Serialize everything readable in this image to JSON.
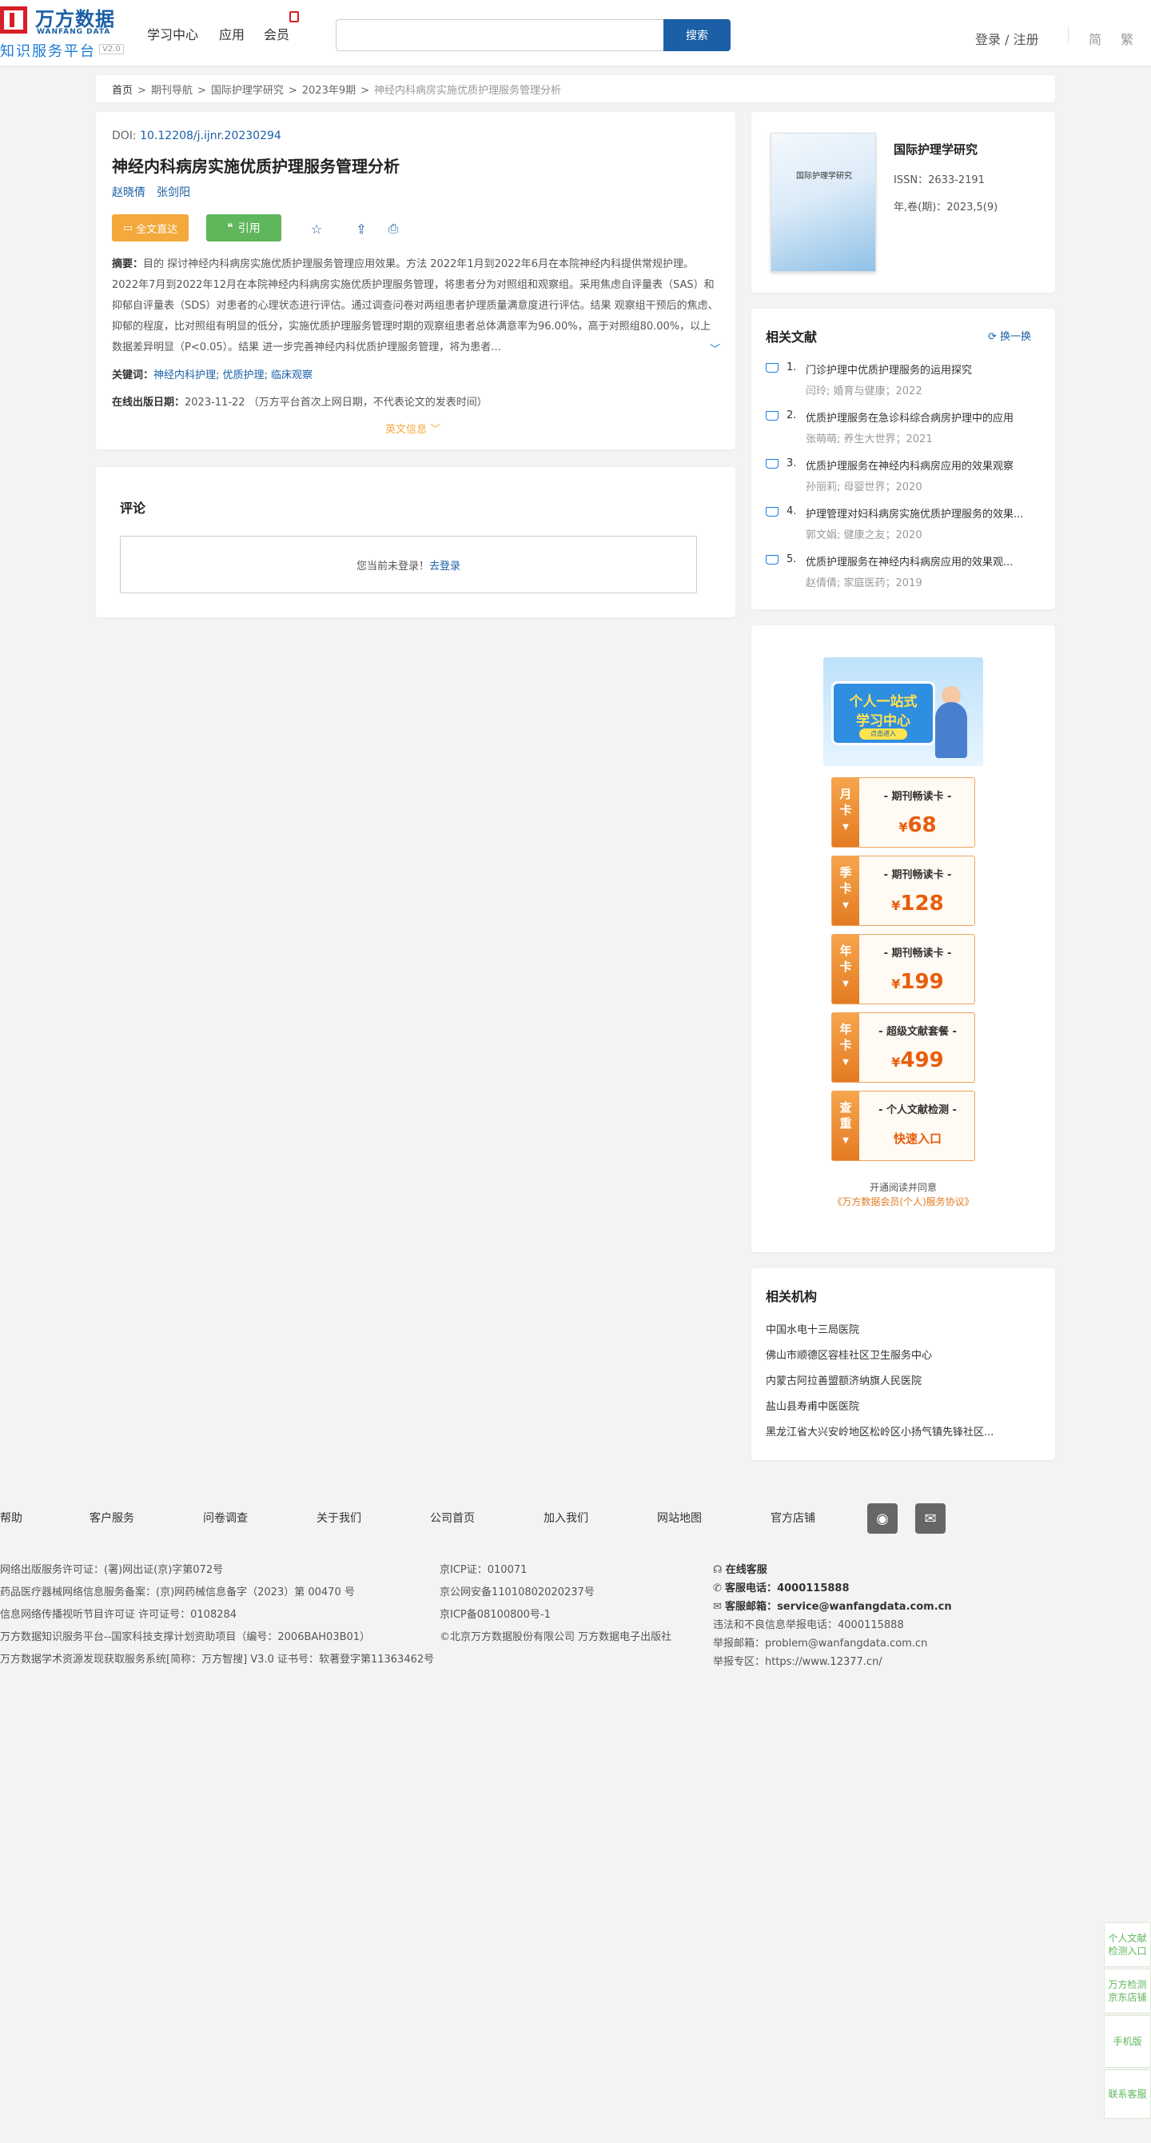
{
  "header": {
    "logo_cn": "万方数据",
    "logo_en": "WANFANG DATA",
    "logo_sub": "知识服务平台",
    "logo_version": "V2.0",
    "nav": [
      "学习中心",
      "应用",
      "会员"
    ],
    "search_placeholder": "",
    "search_button": "搜索",
    "login": "登录 / 注册",
    "lang_simplified": "简",
    "lang_traditional": "繁"
  },
  "breadcrumb": {
    "home": "首页",
    "items": [
      "期刊导航",
      "国际护理学研究",
      "2023年9期"
    ],
    "current": "神经内科病房实施优质护理服务管理分析",
    "separator": ">"
  },
  "article": {
    "doi_label": "DOI:",
    "doi": "10.12208/j.ijnr.20230294",
    "title": "神经内科病房实施优质护理服务管理分析",
    "authors": [
      "赵晓倩",
      "张剑阳"
    ],
    "btn_full": "全文直达",
    "btn_cite": "引用",
    "abstract_label": "摘要：",
    "abstract": "目的 探讨神经内科病房实施优质护理服务管理应用效果。方法 2022年1月到2022年6月在本院神经内科提供常规护理。2022年7月到2022年12月在本院神经内科病房实施优质护理服务管理，将患者分为对照组和观察组。采用焦虑自评量表（SAS）和抑郁自评量表（SDS）对患者的心理状态进行评估。通过调查问卷对两组患者护理质量满意度进行评估。结果 观察组干预后的焦虑、抑郁的程度，比对照组有明显的低分，实施优质护理服务管理时期的观察组患者总体满意率为96.00%，高于对照组80.00%，以上数据差异明显（P<0.05）。结果 进一步完善神经内科优质护理服务管理，将为患者...",
    "keywords_label": "关键词：",
    "keywords": "神经内科护理; 优质护理; 临床观察",
    "online_label": "在线出版日期：",
    "online_date": "2023-11-22",
    "online_note": "（万方平台首次上网日期，不代表论文的发表时间）",
    "en_info": "英文信息"
  },
  "comment": {
    "title": "评论",
    "notice": "您当前未登录！",
    "login_link": "去登录"
  },
  "journal": {
    "cover_title": "国际护理学研究",
    "name": "国际护理学研究",
    "issn": "ISSN：2633-2191",
    "volume": "年,卷(期)：2023,5(9)"
  },
  "related": {
    "title": "相关文献",
    "refresh": "换一换",
    "items": [
      {
        "num": "1.",
        "title": "门诊护理中优质护理服务的运用探究",
        "meta": "闫玲; 婚育与健康；2022"
      },
      {
        "num": "2.",
        "title": "优质护理服务在急诊科综合病房护理中的应用",
        "meta": "张萌萌; 养生大世界；2021"
      },
      {
        "num": "3.",
        "title": "优质护理服务在神经内科病房应用的效果观察",
        "meta": "孙丽莉; 母婴世界；2020"
      },
      {
        "num": "4.",
        "title": "护理管理对妇科病房实施优质护理服务的效果...",
        "meta": "郭文娟; 健康之友；2020"
      },
      {
        "num": "5.",
        "title": "优质护理服务在神经内科病房应用的效果观...",
        "meta": "赵倩倩; 家庭医药；2019"
      }
    ]
  },
  "promo": {
    "banner_line1": "个人一站式",
    "banner_line2": "学习中心",
    "banner_btn": "点击进入",
    "plans": [
      {
        "tag1": "月",
        "tag2": "卡",
        "name": "- 期刊畅读卡 -",
        "currency": "¥",
        "price": "68"
      },
      {
        "tag1": "季",
        "tag2": "卡",
        "name": "- 期刊畅读卡 -",
        "currency": "¥",
        "price": "128"
      },
      {
        "tag1": "年",
        "tag2": "卡",
        "name": "- 期刊畅读卡 -",
        "currency": "¥",
        "price": "199"
      },
      {
        "tag1": "年",
        "tag2": "卡",
        "name": "- 超级文献套餐 -",
        "currency": "¥",
        "price": "499"
      },
      {
        "tag1": "查",
        "tag2": "重",
        "name": "- 个人文献检测 -",
        "currency": "",
        "price": "快速入口"
      }
    ],
    "agree_line1": "开通阅读并同意",
    "agree_link": "《万方数据会员(个人)服务协议》"
  },
  "orgs": {
    "title": "相关机构",
    "items": [
      "中国水电十三局医院",
      "佛山市顺德区容桂社区卫生服务中心",
      "内蒙古阿拉善盟额济纳旗人民医院",
      "盐山县寿甫中医医院",
      "黑龙江省大兴安岭地区松岭区小扬气镇先锋社区..."
    ]
  },
  "footer": {
    "links": [
      "帮助",
      "客户服务",
      "问卷调查",
      "关于我们",
      "公司首页",
      "加入我们",
      "网站地图",
      "官方店铺"
    ],
    "col1": [
      "网络出版服务许可证：(署)网出证(京)字第072号",
      "药品医疗器械网络信息服务备案：(京)网药械信息备字（2023）第 00470 号",
      "信息网络传播视听节目许可证 许可证号：0108284",
      "万方数据知识服务平台--国家科技支撑计划资助项目（编号：2006BAH03B01）",
      "万方数据学术资源发现获取服务系统[简称：万方智搜] V3.0 证书号：软著登字第11363462号"
    ],
    "col2": [
      "京ICP证：010071",
      "京公网安备11010802020237号",
      "京ICP备08100800号-1",
      "©北京万方数据股份有限公司 万方数据电子出版社"
    ],
    "online_service": "在线客服",
    "phone_label": "客服电话：",
    "phone": "4000115888",
    "mail_label": "客服邮箱：",
    "mail": "service@wanfangdata.com.cn",
    "report_phone": "违法和不良信息举报电话：4000115888",
    "report_mail": "举报邮箱：problem@wanfangdata.com.cn",
    "report_zone": "举报专区：https://www.12377.cn/"
  },
  "side_tabs": [
    "个人文献检测入口",
    "万方检测京东店铺",
    "手机版",
    "联系客服"
  ]
}
